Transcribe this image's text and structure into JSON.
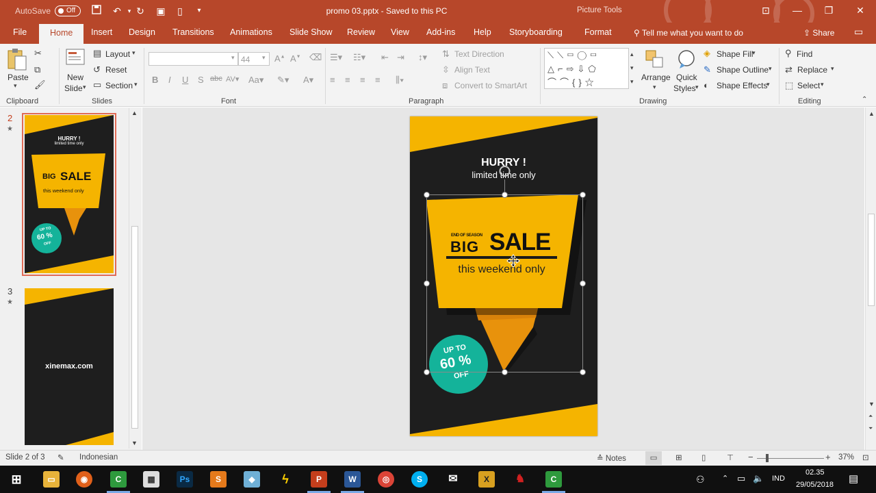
{
  "titlebar": {
    "autosave_label": "AutoSave",
    "autosave_state": "Off",
    "doc_title": "promo 03.pptx  -  Saved to this PC",
    "context_tab_group": "Picture Tools"
  },
  "tabs": [
    "File",
    "Home",
    "Insert",
    "Design",
    "Transitions",
    "Animations",
    "Slide Show",
    "Review",
    "View",
    "Add-ins",
    "Help",
    "Storyboarding",
    "Format"
  ],
  "active_tab": "Home",
  "tell_me": "Tell me what you want to do",
  "share_label": "Share",
  "ribbon": {
    "clipboard": {
      "label": "Clipboard",
      "paste": "Paste"
    },
    "slides": {
      "label": "Slides",
      "new_slide_1": "New",
      "new_slide_2": "Slide",
      "layout": "Layout",
      "reset": "Reset",
      "section": "Section"
    },
    "font": {
      "label": "Font",
      "font_size": "44"
    },
    "paragraph": {
      "label": "Paragraph",
      "text_direction": "Text Direction",
      "align_text": "Align Text",
      "smartart": "Convert to SmartArt"
    },
    "drawing": {
      "label": "Drawing",
      "arrange": "Arrange",
      "quick_1": "Quick",
      "quick_2": "Styles",
      "shape_fill": "Shape Fill",
      "shape_outline": "Shape Outline",
      "shape_effects": "Shape Effects"
    },
    "editing": {
      "label": "Editing",
      "find": "Find",
      "replace": "Replace",
      "select": "Select"
    }
  },
  "thumbnails": [
    {
      "number": "2",
      "hurry": "HURRY !",
      "limited": "limited time only",
      "big": "BIG",
      "sale": "SALE",
      "weekend": "this weekend only",
      "up_to": "UP TO",
      "pct": "60 %",
      "off": "OFF"
    },
    {
      "number": "3",
      "site": "xinemax.com"
    }
  ],
  "slide": {
    "hurry": "HURRY !",
    "limited": "limited time only",
    "end_of_season": "END OF SEASON",
    "big": "BIG",
    "sale": "SALE",
    "weekend": "this weekend only",
    "up_to": "UP TO",
    "pct": "60 %",
    "off": "OFF"
  },
  "status": {
    "slide_count": "Slide 2 of 3",
    "language": "Indonesian",
    "notes": "Notes",
    "zoom": "37%"
  },
  "taskbar": {
    "lang": "IND",
    "time": "02.35",
    "date": "29/05/2018"
  },
  "colors": {
    "accent": "#b7472a",
    "slide_bg": "#1e1e1e",
    "yellow": "#f5b400",
    "orange": "#e8920c",
    "teal": "#14b39a"
  }
}
